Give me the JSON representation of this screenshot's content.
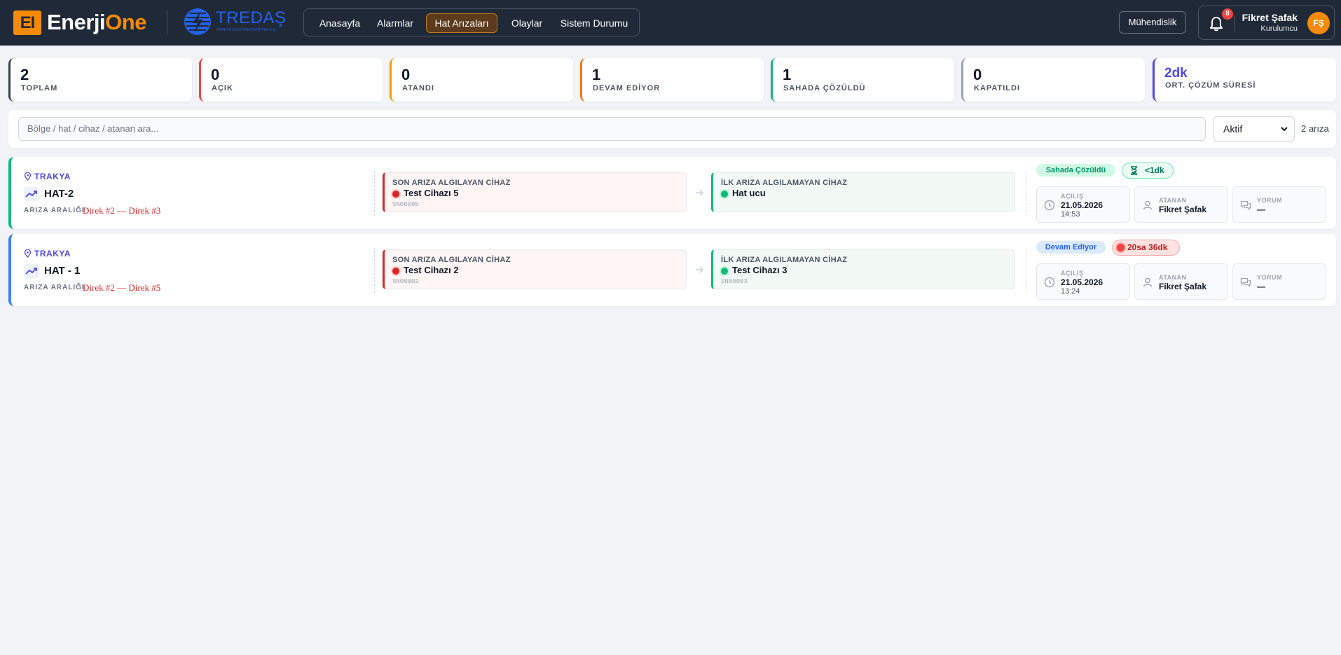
{
  "header": {
    "logo_mark": "EI",
    "logo_word_1": "Enerji",
    "logo_word_2": "One",
    "partner_name": "TREDAŞ",
    "partner_sub": "TRAKYA ELEKTRİK DAĞITIM A.Ş.",
    "nav": [
      {
        "label": "Anasayfa",
        "active": false
      },
      {
        "label": "Alarmlar",
        "active": false
      },
      {
        "label": "Hat Arızaları",
        "active": true
      },
      {
        "label": "Olaylar",
        "active": false
      },
      {
        "label": "Sistem Durumu",
        "active": false
      }
    ],
    "mode_button": "Mühendislik",
    "notification_count": "8",
    "user_name": "Fikret Şafak",
    "user_role": "Kurulumcu",
    "user_initials": "FŞ"
  },
  "stats": [
    {
      "value": "2",
      "label": "TOPLAM",
      "color": "#374151"
    },
    {
      "value": "0",
      "label": "AÇIK",
      "color": "#ef4444"
    },
    {
      "value": "0",
      "label": "ATANDI",
      "color": "#f59e0b"
    },
    {
      "value": "1",
      "label": "DEVAM EDİYOR",
      "color": "#f97316"
    },
    {
      "value": "1",
      "label": "SAHADA ÇÖZÜLDÜ",
      "color": "#10b981"
    },
    {
      "value": "0",
      "label": "KAPATILDI",
      "color": "#94a3b8"
    },
    {
      "value": "2dk",
      "label": "ORT. ÇÖZÜM SÜRESİ",
      "color": "#4f46e5"
    }
  ],
  "filter": {
    "search_placeholder": "Bölge / hat / cihaz / atanan ara...",
    "status_selected": "Aktif",
    "result_count": "2 arıza"
  },
  "faults": [
    {
      "region": "TRAKYA",
      "line": "HAT-2",
      "range_label": "ARIZA ARALIĞI",
      "range": "Direk #2 — Direk #3",
      "border_color": "#10b981",
      "last_detecting_label": "SON ARIZA ALGILAYAN CİHAZ",
      "last_detecting_name": "Test Cihazı 5",
      "last_detecting_sn": "SN00005",
      "first_clear_label": "İLK ARIZA ALGILAMAYAN CİHAZ",
      "first_clear_name": "Hat ucu",
      "first_clear_sn": "",
      "status": "Sahada Çözüldü",
      "status_tone": "green",
      "timer": "<1dk",
      "timer_icon": "hourglass-icon",
      "opened_label": "AÇILIŞ",
      "opened_date": "21.05.2026",
      "opened_time": "14:53",
      "assignee_label": "ATANAN",
      "assignee": "Fikret Şafak",
      "comment_label": "YORUM",
      "comment": "—"
    },
    {
      "region": "TRAKYA",
      "line": "HAT - 1",
      "range_label": "ARIZA ARALIĞI",
      "range": "Direk #2 — Direk #5",
      "border_color": "#3b82f6",
      "last_detecting_label": "SON ARIZA ALGILAYAN CİHAZ",
      "last_detecting_name": "Test Cihazı 2",
      "last_detecting_sn": "SN00002",
      "first_clear_label": "İLK ARIZA ALGILAMAYAN CİHAZ",
      "first_clear_name": "Test Cihazı 3",
      "first_clear_sn": "SN00003",
      "status": "Devam Ediyor",
      "status_tone": "blue",
      "timer": "20sa 36dk",
      "timer_icon": "live-dot-icon",
      "opened_label": "AÇILIŞ",
      "opened_date": "21.05.2026",
      "opened_time": "13:24",
      "assignee_label": "ATANAN",
      "assignee": "Fikret Şafak",
      "comment_label": "YORUM",
      "comment": "—"
    }
  ]
}
